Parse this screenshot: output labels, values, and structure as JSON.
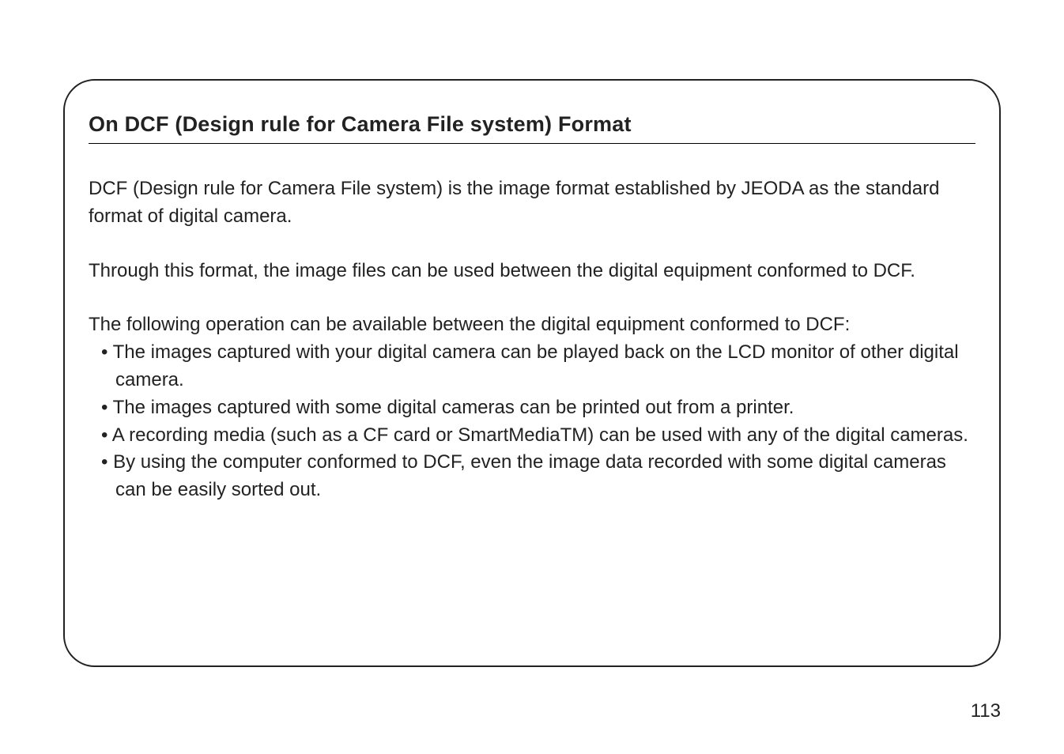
{
  "heading": "On DCF (Design rule for Camera File system) Format",
  "paragraphs": {
    "p1": "DCF (Design rule for Camera File system) is the image format established by JEODA as the standard format of digital camera.",
    "p2": "Through this format, the image files can be used between the digital equipment conformed to DCF.",
    "p3": "The following operation can be available between the digital equipment conformed to DCF:"
  },
  "bullets": [
    "The images captured with your digital camera can be played back on the LCD monitor of other digital camera.",
    "The images captured with some digital cameras can be printed out from a printer.",
    " A recording media (such as a CF card or SmartMediaTM) can be used with any of the digital cameras.",
    "By using the computer conformed to DCF, even the image data recorded with some digital cameras can be easily sorted out."
  ],
  "page_number": "113"
}
